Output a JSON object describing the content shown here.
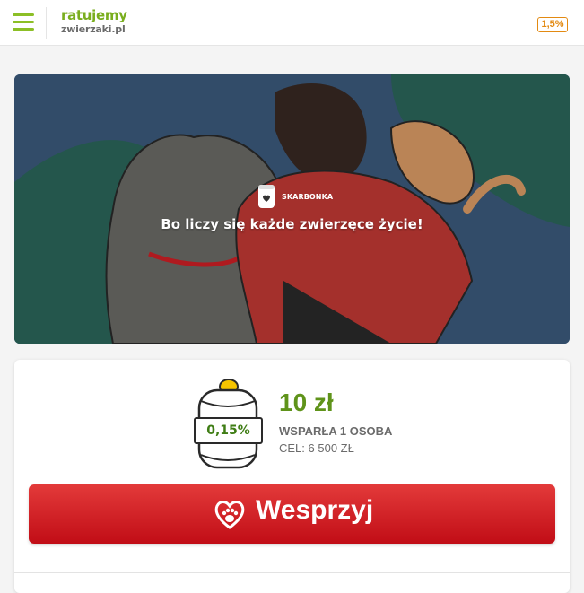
{
  "header": {
    "logo_top": "ratujemy",
    "logo_bottom": "zwierzaki.pl",
    "badge": "1,5%"
  },
  "hero": {
    "category_label": "SKARBONKA",
    "title": "Bo liczy się każde zwierzęce życie!"
  },
  "campaign": {
    "percent": "0,15%",
    "amount": "10 zł",
    "supporters": "WSPARŁA 1 OSOBA",
    "goal": "CEL: 6 500 ZŁ",
    "progress_fraction": 0.0015
  },
  "actions": {
    "support_label": "Wesprzyj"
  },
  "colors": {
    "brand_green": "#8cbf26",
    "accent_orange": "#e38a12",
    "button_red": "#d62027",
    "amount_green": "#5f931a"
  }
}
